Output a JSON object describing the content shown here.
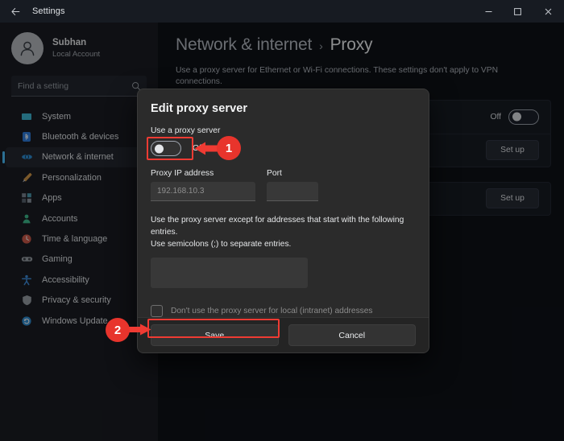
{
  "window": {
    "title": "Settings",
    "back_icon": "back-arrow-icon",
    "controls": {
      "minimize": "minimize-icon",
      "maximize": "maximize-icon",
      "close": "close-icon"
    }
  },
  "sidebar": {
    "account": {
      "name": "Subhan",
      "subtitle": "Local Account",
      "avatar_icon": "person-avatar-icon"
    },
    "search": {
      "placeholder": "Find a setting",
      "value": "",
      "icon": "search-icon"
    },
    "items": [
      {
        "label": "System",
        "icon": "monitor-icon",
        "color": "#3fb9d6",
        "active": false
      },
      {
        "label": "Bluetooth & devices",
        "icon": "bluetooth-icon",
        "color": "#2f7ee0",
        "active": false
      },
      {
        "label": "Network & internet",
        "icon": "network-icon",
        "color": "#2f8fd6",
        "active": true
      },
      {
        "label": "Personalization",
        "icon": "brush-icon",
        "color": "#d69b4a",
        "active": false
      },
      {
        "label": "Apps",
        "icon": "apps-icon",
        "color": "#6f7a86",
        "active": false
      },
      {
        "label": "Accounts",
        "icon": "accounts-icon",
        "color": "#3fbd8f",
        "active": false
      },
      {
        "label": "Time & language",
        "icon": "clock-icon",
        "color": "#cf5b4a",
        "active": false
      },
      {
        "label": "Gaming",
        "icon": "gamepad-icon",
        "color": "#9aa0a8",
        "active": false
      },
      {
        "label": "Accessibility",
        "icon": "accessibility-icon",
        "color": "#3f8fe0",
        "active": false
      },
      {
        "label": "Privacy & security",
        "icon": "shield-icon",
        "color": "#9aa0a8",
        "active": false
      },
      {
        "label": "Windows Update",
        "icon": "update-icon",
        "color": "#2f8fd6",
        "active": false
      }
    ]
  },
  "main": {
    "breadcrumb_parent": "Network & internet",
    "breadcrumb_separator": "›",
    "breadcrumb_current": "Proxy",
    "description": "Use a proxy server for Ethernet or Wi-Fi connections. These settings don't apply to VPN connections.",
    "rows": [
      {
        "type": "toggle",
        "state_label": "Off",
        "checked": false
      },
      {
        "type": "button",
        "label": "Set up"
      },
      {
        "type": "button",
        "label": "Set up"
      }
    ]
  },
  "dialog": {
    "title": "Edit proxy server",
    "use_proxy_label": "Use a proxy server",
    "use_proxy_state": "Off",
    "use_proxy_checked": false,
    "ip_label": "Proxy IP address",
    "ip_placeholder": "192.168.10.3",
    "ip_value": "",
    "port_label": "Port",
    "port_placeholder": "",
    "port_value": "",
    "exceptions_text_line1": "Use the proxy server except for addresses that start with the following entries.",
    "exceptions_text_line2": "Use semicolons (;) to separate entries.",
    "exceptions_value": "",
    "exceptions_placeholder": "",
    "local_checkbox_label": "Don't use the proxy server for local (intranet) addresses",
    "local_checkbox_checked": false,
    "save_label": "Save",
    "cancel_label": "Cancel"
  },
  "annotations": {
    "accent_color": "#e8342c",
    "steps": [
      {
        "number": "1",
        "target": "use-proxy-toggle"
      },
      {
        "number": "2",
        "target": "save-button"
      }
    ]
  }
}
